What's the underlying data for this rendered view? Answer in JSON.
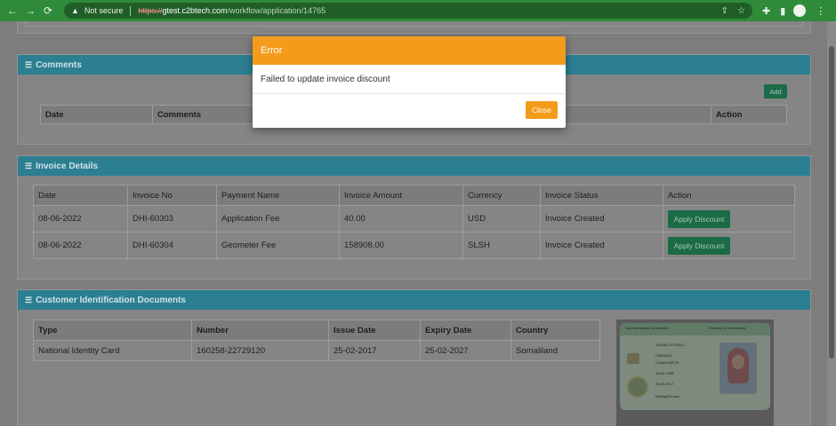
{
  "browser": {
    "back_icon": "←",
    "forward_icon": "→",
    "reload_icon": "⟳",
    "security_label": "Not secure",
    "url_scheme": "https://",
    "url_host": "gtest.c2btech.com",
    "url_path": "/workflow/application/14765"
  },
  "comments": {
    "title": "Comments",
    "add_label": "Add",
    "columns": [
      "Date",
      "Comments",
      "Action"
    ]
  },
  "invoice": {
    "title": "Invoice Details",
    "columns": [
      "Date",
      "Invoice No",
      "Payment Name",
      "Invoice Amount",
      "Currency",
      "Invoice Status",
      "Action"
    ],
    "rows": [
      {
        "date": "08-06-2022",
        "invoice_no": "DHI-60303",
        "payment_name": "Application Fee",
        "amount": "40.00",
        "currency": "USD",
        "status": "Invoice Created",
        "action": "Apply Discount"
      },
      {
        "date": "08-06-2022",
        "invoice_no": "DHI-60304",
        "payment_name": "Geometer Fee",
        "amount": "158908.00",
        "currency": "SLSH",
        "status": "Invoice Created",
        "action": "Apply Discount"
      }
    ]
  },
  "customer_docs": {
    "title": "Customer Identification Documents",
    "columns": [
      "Type",
      "Number",
      "Issue Date",
      "Expiry Date",
      "Country"
    ],
    "rows": [
      {
        "type": "National Identity Card",
        "number": "160258-22729120",
        "issue_date": "25-02-2017",
        "expiry_date": "25-02-2027",
        "country": "Somaliland"
      }
    ],
    "card_text": {
      "left_header": "Jamhuuriyadda Somaliland",
      "right_header": "Republic of Somaliland",
      "number": "160258-22729120",
      "name": "CIMAADO",
      "surname": "CAABI ASEYE",
      "dob": "16-02-1958",
      "issue": "25-02-2017",
      "gender": "Dhedig/Female"
    }
  },
  "modal": {
    "title": "Error",
    "message": "Failed to update invoice discount",
    "close_label": "Close"
  },
  "colors": {
    "browser_bar": "#2f8a3a",
    "panel_header": "#2b7f91",
    "modal_accent": "#f39c1c",
    "success_button": "#1a6b46"
  }
}
